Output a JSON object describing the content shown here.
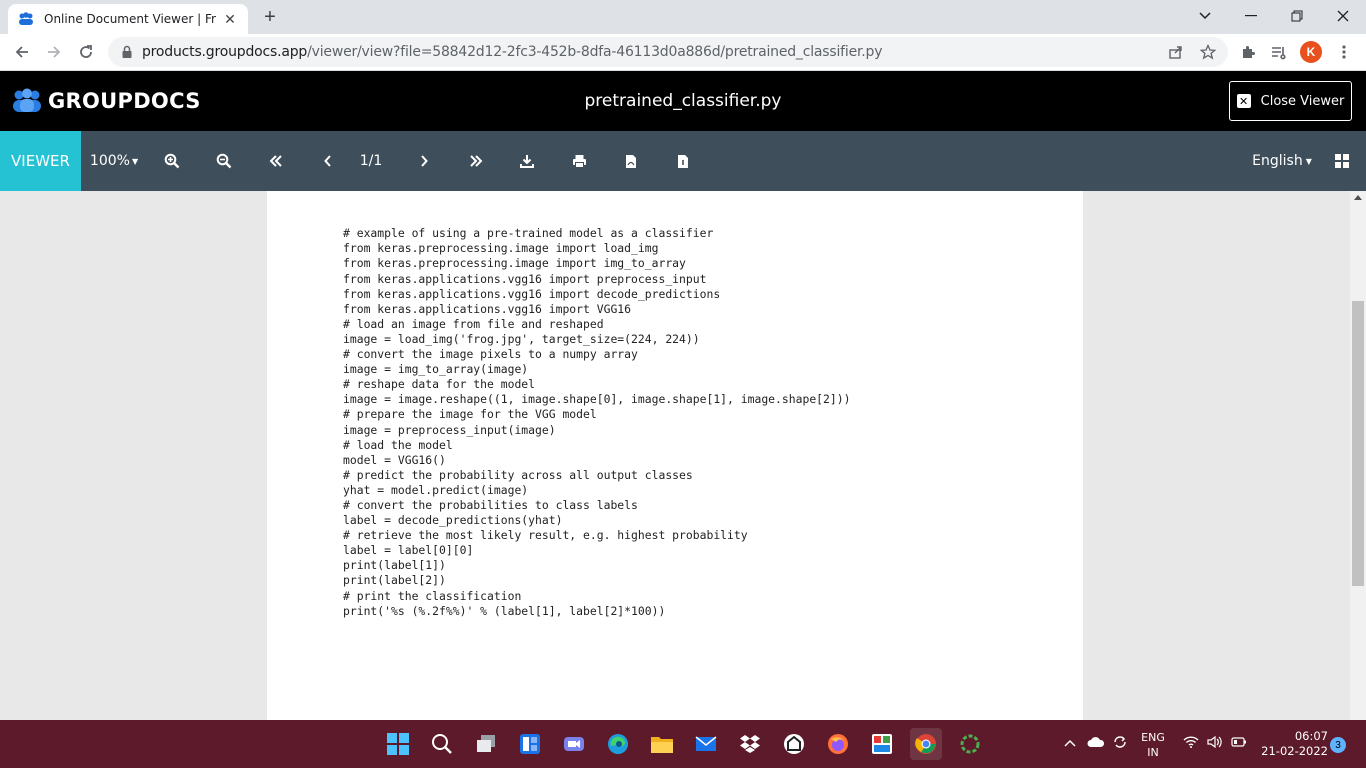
{
  "browser": {
    "tab_title": "Online Document Viewer | Free G",
    "url_host": "products.groupdocs.app",
    "url_path": "/viewer/view?file=58842d12-2fc3-452b-8dfa-46113d0a886d/pretrained_classifier.py",
    "profile_initial": "K"
  },
  "app": {
    "brand": "GROUPDOCS",
    "document_title": "pretrained_classifier.py",
    "close_viewer_label": "Close Viewer"
  },
  "viewer_toolbar": {
    "mode_label": "VIEWER",
    "zoom": "100%",
    "page_indicator": "1/1",
    "language": "English"
  },
  "document": {
    "lines": [
      "\"\"\"",
      "",
      "",
      "# example of using a pre-trained model as a classifier",
      "from keras.preprocessing.image import load_img",
      "from keras.preprocessing.image import img_to_array",
      "from keras.applications.vgg16 import preprocess_input",
      "from keras.applications.vgg16 import decode_predictions",
      "from keras.applications.vgg16 import VGG16",
      "# load an image from file and reshaped",
      "image = load_img('frog.jpg', target_size=(224, 224))",
      "# convert the image pixels to a numpy array",
      "image = img_to_array(image)",
      "# reshape data for the model",
      "image = image.reshape((1, image.shape[0], image.shape[1], image.shape[2]))",
      "# prepare the image for the VGG model",
      "image = preprocess_input(image)",
      "# load the model",
      "model = VGG16()",
      "# predict the probability across all output classes",
      "yhat = model.predict(image)",
      "# convert the probabilities to class labels",
      "label = decode_predictions(yhat)",
      "# retrieve the most likely result, e.g. highest probability",
      "label = label[0][0]",
      "print(label[1])",
      "print(label[2])",
      "# print the classification",
      "print('%s (%.2f%%)' % (label[1], label[2]*100))"
    ]
  },
  "taskbar": {
    "language_line1": "ENG",
    "language_line2": "IN",
    "time": "06:07",
    "date": "21-02-2022",
    "notification_count": "3"
  },
  "colors": {
    "viewer_accent": "#25c2d4",
    "toolbar_bg": "#3e4e5a",
    "header_bg": "#000000",
    "taskbar_bg": "#5c1a2a"
  }
}
